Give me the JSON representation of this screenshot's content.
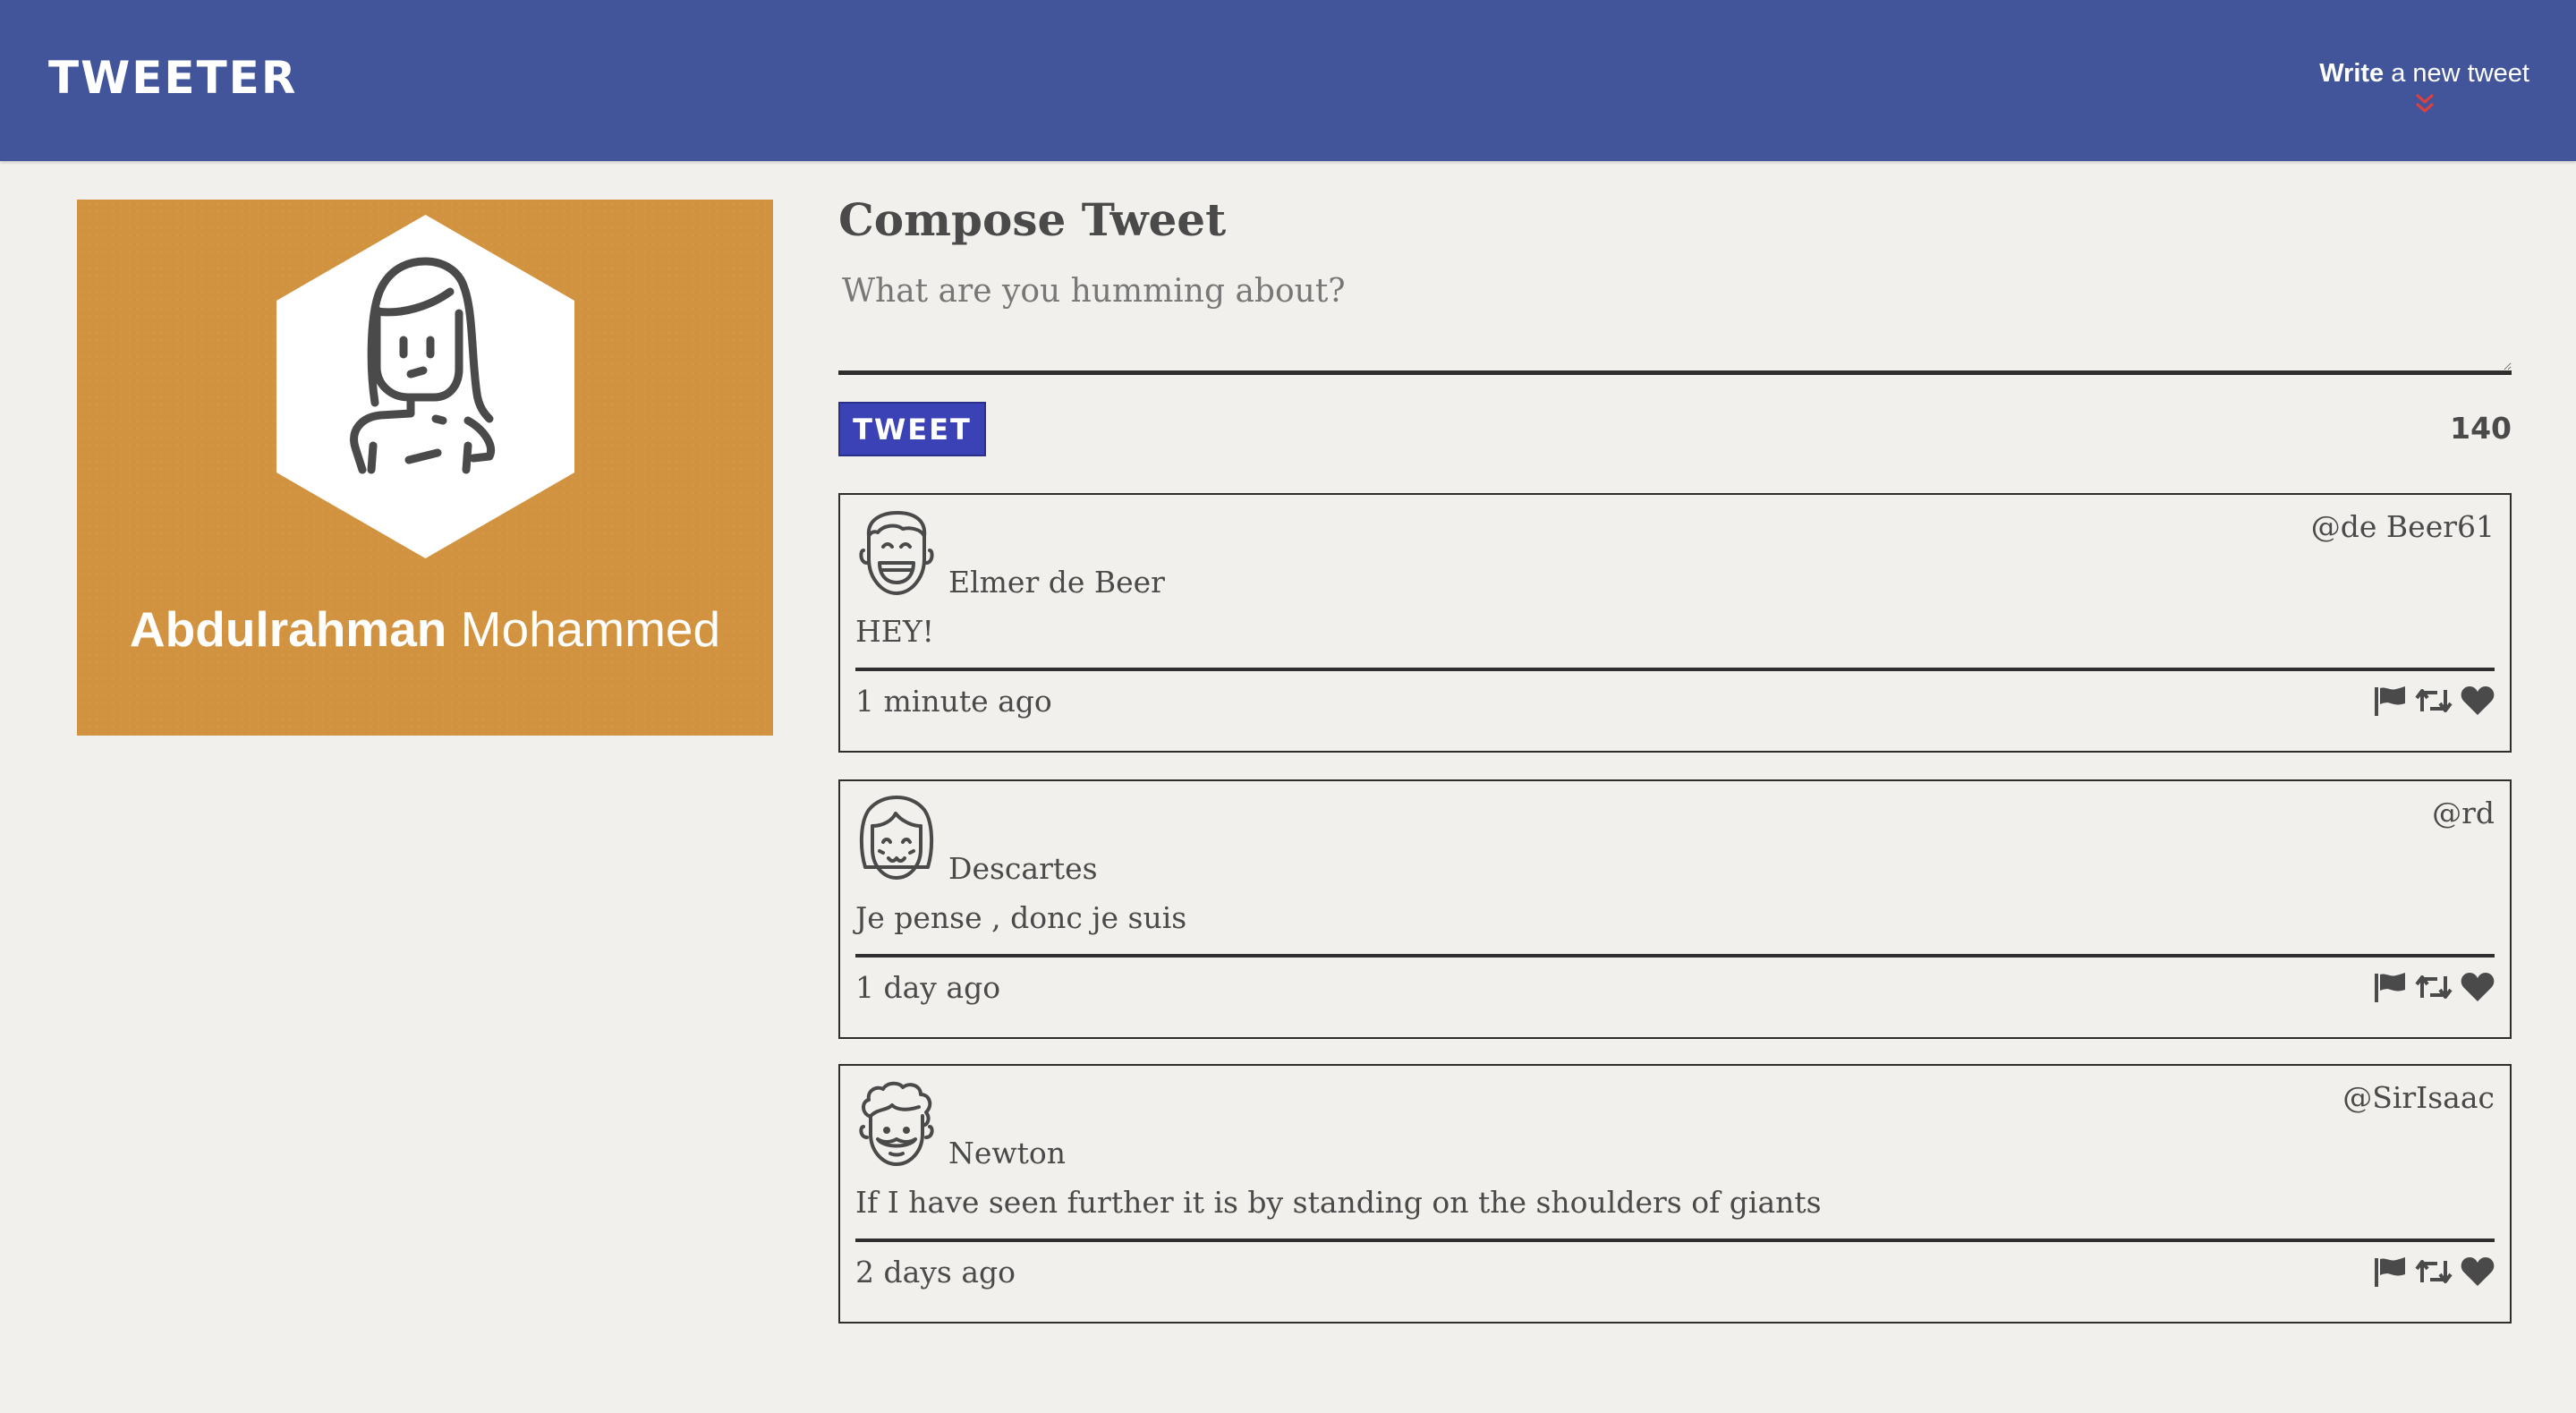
{
  "navbar": {
    "brand": "TWEETER",
    "compose_toggle": {
      "label_bold": "Write",
      "label_rest": " a new tweet",
      "icon": "double-chevron-down-icon",
      "icon_color": "#e0403a"
    },
    "background_color": "#42559b"
  },
  "profile": {
    "first_name": "Abdulrahman",
    "last_name": " Mohammed",
    "avatar_icon": "woman-avatar-icon",
    "background_color": "#d29341"
  },
  "compose": {
    "title": "Compose Tweet",
    "placeholder": "What are you humming about?",
    "value": "",
    "button_label": "TWEET",
    "char_counter": "140",
    "button_color": "#3b42b5"
  },
  "tweets": [
    {
      "name": "Elmer de Beer",
      "handle": "@de Beer61",
      "content": "HEY!",
      "timestamp": "1 minute ago",
      "avatar_icon": "smiling-man-avatar-icon"
    },
    {
      "name": "Descartes",
      "handle": "@rd",
      "content": "Je pense , donc je suis",
      "timestamp": "1 day ago",
      "avatar_icon": "bob-hair-avatar-icon"
    },
    {
      "name": "Newton",
      "handle": "@SirIsaac",
      "content": "If I have seen further it is by standing on the shoulders of giants",
      "timestamp": "2 days ago",
      "avatar_icon": "curly-hair-avatar-icon"
    }
  ],
  "tweet_actions": [
    "flag-icon",
    "retweet-icon",
    "heart-icon"
  ]
}
